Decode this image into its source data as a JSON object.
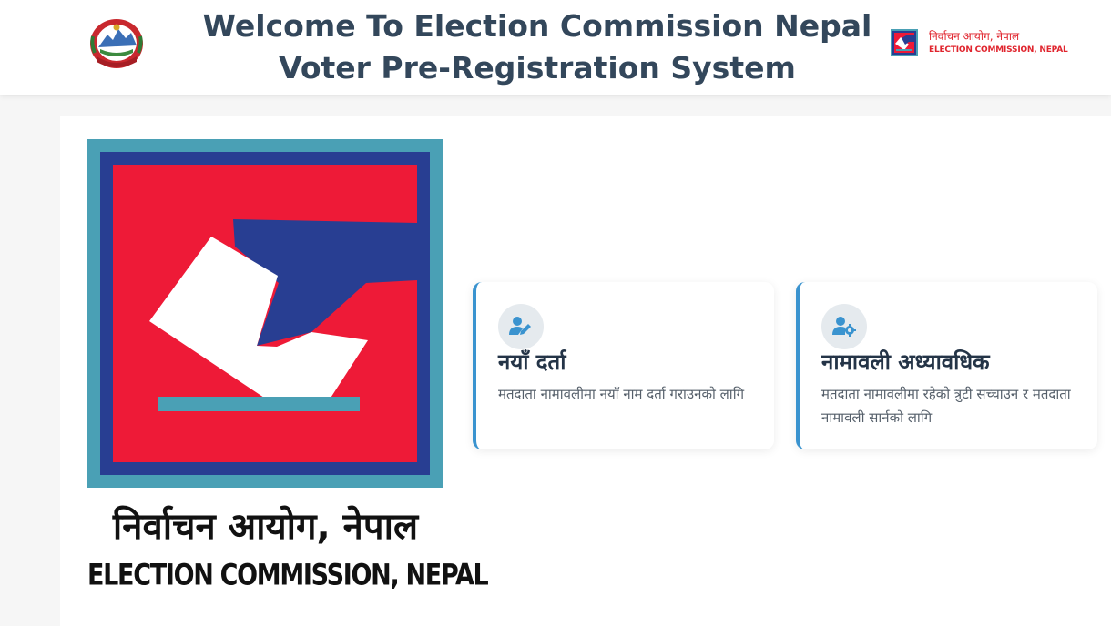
{
  "header": {
    "title_line1": "Welcome To Election Commission Nepal",
    "title_line2": "Voter Pre-Registration System",
    "emblem_icon": "nepal-government-emblem-icon",
    "logo": {
      "icon": "ballot-box-logo-icon",
      "nepali_text": "निर्वाचन आयोग, नेपाल",
      "english_text": "ELECTION COMMISSION, NEPAL"
    }
  },
  "main_logo": {
    "icon": "ballot-box-logo-icon",
    "nepali_text": "निर्वाचन आयोग, नेपाल",
    "english_text": "ELECTION COMMISSION, NEPAL"
  },
  "cards": [
    {
      "icon": "user-edit-icon",
      "title": "नयाँ दर्ता",
      "description": "मतदाता नामावलीमा नयाँ नाम दर्ता गराउनको लागि"
    },
    {
      "icon": "user-settings-icon",
      "title": "नामावली अध्यावधिक",
      "description": "मतदाता नामावलीमा रहेको त्रुटी सच्चाउन र मतदाता नामावली सार्नको लागि"
    }
  ],
  "colors": {
    "brand_red": "#ee1a37",
    "brand_blue": "#283e92",
    "brand_teal": "#4aa0b5",
    "card_accent": "#3a93cf",
    "title_text": "#33475b"
  }
}
